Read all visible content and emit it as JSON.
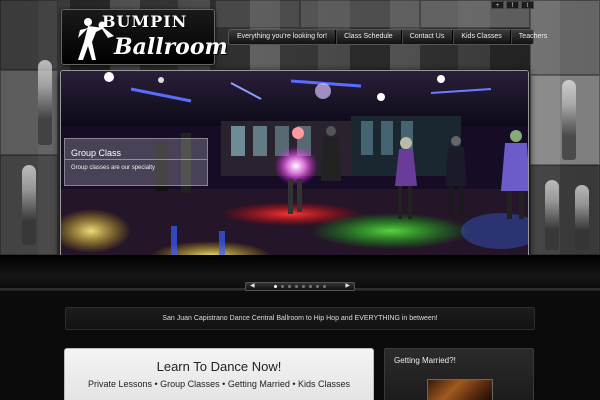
{
  "logo": {
    "line1": "BUMPIN",
    "line2": "Ballroom"
  },
  "social": [
    "+",
    "f",
    "t"
  ],
  "nav": {
    "items": [
      {
        "label": "Everything you're looking for!"
      },
      {
        "label": "Class Schedule"
      },
      {
        "label": "Contact Us"
      },
      {
        "label": "Kids Classes"
      },
      {
        "label": "Teachers"
      }
    ]
  },
  "slider": {
    "caption_title": "Group Class",
    "caption_text": "Group classes are our specialty",
    "prev_icon": "◀",
    "next_icon": "▶",
    "slide_count": 8,
    "active_slide": 1
  },
  "tagline": "San Juan Capistrano Dance Central Ballroom to Hip Hop and EVERYTHING in between!",
  "learn": {
    "title": "Learn To Dance Now!",
    "links": "Private Lessons • Group Classes • Getting Married • Kids Classes"
  },
  "widget": {
    "title": "Getting Married?!"
  },
  "colors": {
    "background": "#0b0b0b",
    "panel_light": "#f4f4f4",
    "nav_dark": "#111111"
  }
}
